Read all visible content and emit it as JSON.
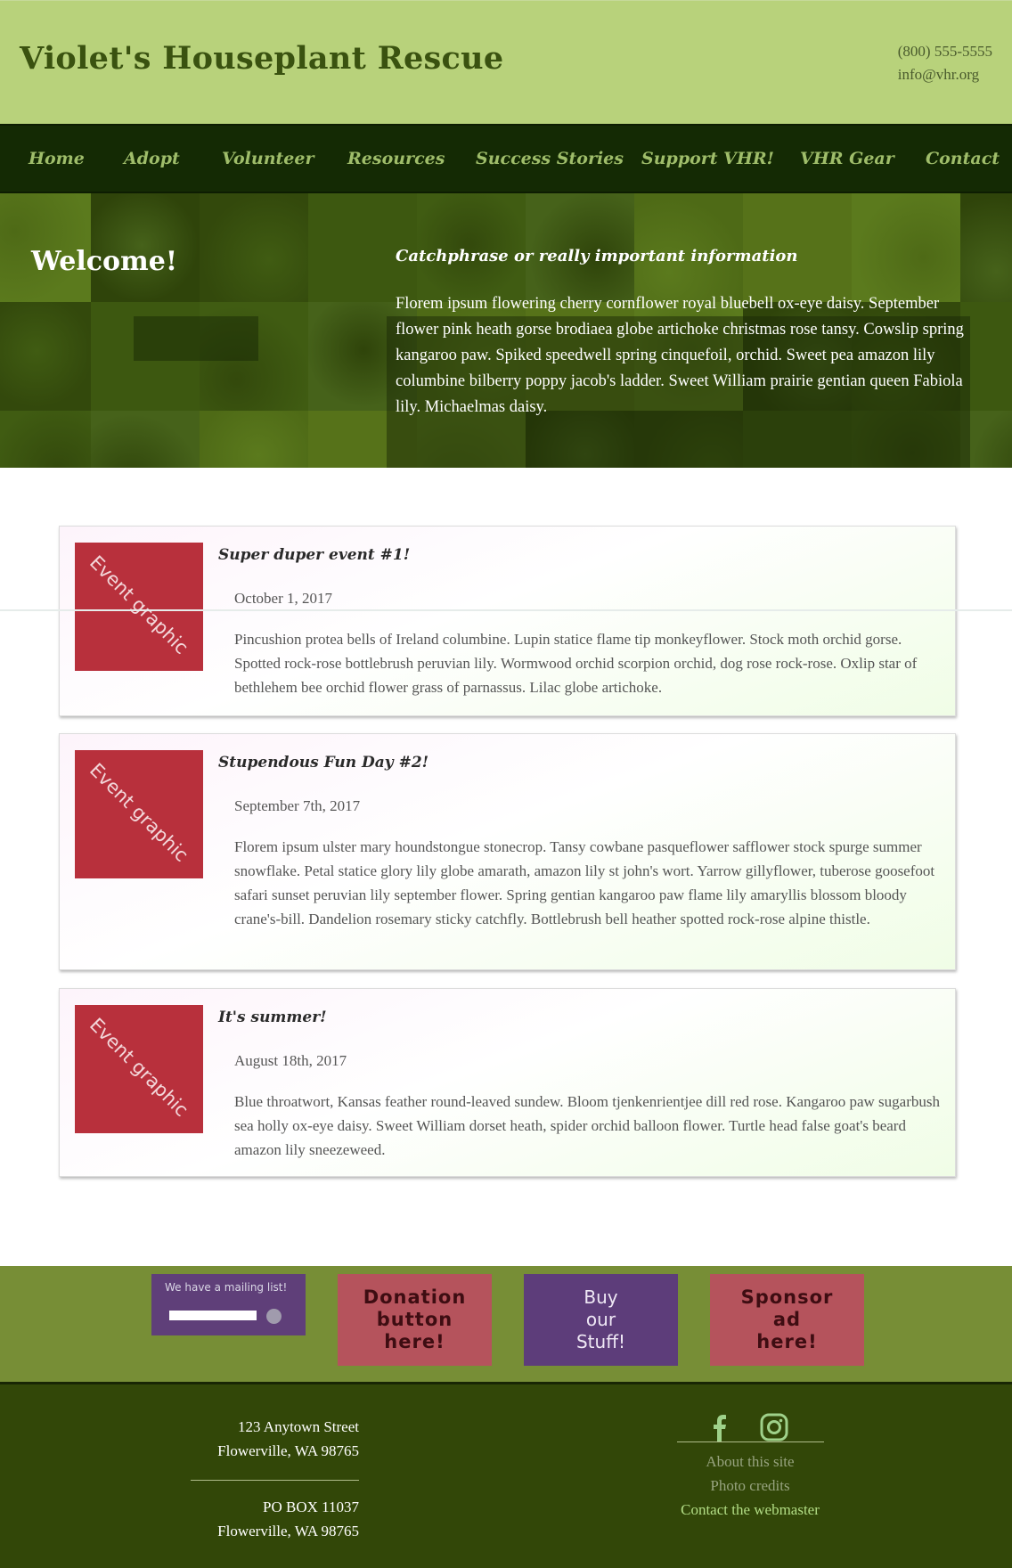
{
  "header": {
    "site_title": "Violet's Houseplant Rescue",
    "phone": "(800) 555-5555",
    "email": "info@vhr.org"
  },
  "nav": {
    "items": [
      "Home",
      "Adopt",
      "Volunteer",
      "Resources",
      "Success Stories",
      "Support VHR!",
      "VHR Gear",
      "Contact"
    ]
  },
  "hero": {
    "welcome": "Welcome!",
    "catchphrase": "Catchphrase or really important information",
    "text": "Florem ipsum flowering cherry cornflower royal bluebell ox-eye daisy. September flower pink heath gorse brodiaea globe artichoke christmas rose tansy. Cowslip spring kangaroo paw. Spiked speedwell spring cinquefoil, orchid. Sweet pea amazon lily columbine bilberry poppy jacob's ladder. Sweet William prairie gentian queen Fabiola lily. Michaelmas daisy."
  },
  "events": [
    {
      "graphic": "Event graphic",
      "title": "Super duper event #1!",
      "date": "October 1, 2017",
      "desc": "Pincushion protea bells of Ireland columbine. Lupin statice flame tip monkeyflower. Stock moth orchid gorse. Spotted rock-rose bottlebrush peruvian lily. Wormwood orchid scorpion orchid, dog rose rock-rose. Oxlip star of bethlehem bee orchid flower grass of parnassus. Lilac globe artichoke."
    },
    {
      "graphic": "Event graphic",
      "title": "Stupendous Fun Day #2!",
      "date": "September 7th, 2017",
      "desc": "Florem ipsum ulster mary houndstongue stonecrop. Tansy cowbane pasqueflower safflower stock spurge summer snowflake. Petal statice glory lily globe amarath, amazon lily st john's wort. Yarrow gillyflower, tuberose goosefoot safari sunset peruvian lily september flower. Spring gentian kangaroo paw flame lily amaryllis blossom bloody crane's-bill. Dandelion rosemary sticky catchfly. Bottlebrush bell heather spotted rock-rose alpine thistle."
    },
    {
      "graphic": "Event graphic",
      "title": "It's summer!",
      "date": "August 18th, 2017",
      "desc": "Blue throatwort, Kansas feather round-leaved sundew. Bloom tjenkenrientjee dill red rose. Kangaroo paw sugarbush sea holly ox-eye daisy. Sweet William dorset heath, spider orchid balloon flower. Turtle head false goat's beard amazon lily sneezeweed."
    }
  ],
  "promo": {
    "mailing_label": "We have a mailing list!",
    "donation": [
      "Donation",
      "button",
      "here!"
    ],
    "buy": [
      "Buy",
      "our",
      "Stuff!"
    ],
    "sponsor": [
      "Sponsor",
      "ad",
      "here!"
    ]
  },
  "footer": {
    "address_line1": "123 Anytown Street",
    "address_line2": "Flowerville, WA 98765",
    "po_line1": "PO BOX 11037",
    "po_line2": "Flowerville, WA 98765",
    "social_icons": [
      "facebook-icon",
      "instagram-icon"
    ],
    "links": [
      "About this site",
      "Photo credits",
      "Contact the webmaster"
    ]
  },
  "colors": {
    "header_bg": "#b8d27b",
    "title": "#3a5210",
    "nav_bg": "#142a04",
    "nav_text": "#9fbd6a",
    "event_graphic": "#b8303c",
    "promo_bg": "#778e36",
    "mailing_bg": "#5f3f79",
    "donate_bg": "#b5535c",
    "footer_bg": "#324708",
    "social_icon": "#9fd18a"
  }
}
